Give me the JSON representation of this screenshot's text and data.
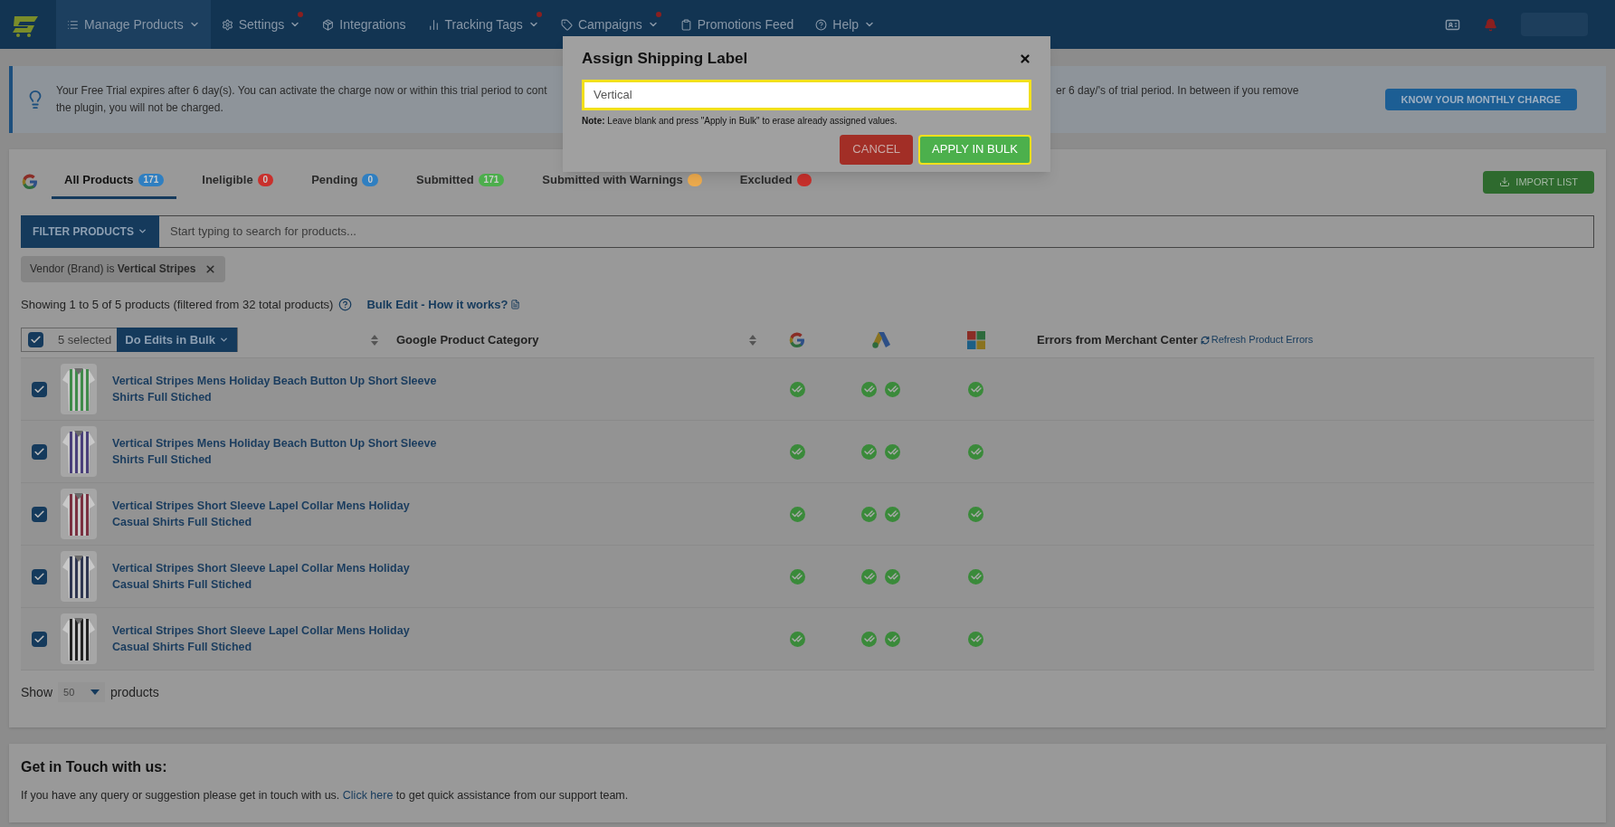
{
  "nav": {
    "items": [
      {
        "label": "Manage Products",
        "selected": true,
        "caret": true,
        "dot": false
      },
      {
        "label": "Settings",
        "selected": false,
        "caret": true,
        "dot": true
      },
      {
        "label": "Integrations",
        "selected": false,
        "caret": false,
        "dot": false
      },
      {
        "label": "Tracking Tags",
        "selected": false,
        "caret": true,
        "dot": true
      },
      {
        "label": "Campaigns",
        "selected": false,
        "caret": true,
        "dot": true
      },
      {
        "label": "Promotions Feed",
        "selected": false,
        "caret": false,
        "dot": false
      },
      {
        "label": "Help",
        "selected": false,
        "caret": true,
        "dot": false
      }
    ]
  },
  "banner": {
    "text_left": "Your Free Trial expires after 6 day(s). You can activate the charge now or within this trial period to cont",
    "text_right": "er 6 day/'s of trial period. In between if you remove",
    "text_line2": "the plugin, you will not be charged.",
    "button": "KNOW YOUR MONTHLY CHARGE"
  },
  "tabs": [
    {
      "label": "All Products",
      "count": "171",
      "color": "#2f7fc1",
      "selected": true
    },
    {
      "label": "Ineligible",
      "count": "0",
      "color": "#c9302c",
      "selected": false
    },
    {
      "label": "Pending",
      "count": "0",
      "color": "#2f7fc1",
      "selected": false
    },
    {
      "label": "Submitted",
      "count": "171",
      "color": "#4cae4c",
      "selected": false
    },
    {
      "label": "Submitted with Warnings",
      "color": "#f0ad4e",
      "selected": false
    },
    {
      "label": "Excluded",
      "color": "#c9302c",
      "selected": false
    }
  ],
  "import_button": "IMPORT LIST",
  "filter": {
    "button": "FILTER PRODUCTS",
    "placeholder": "Start typing to search for products..."
  },
  "chip": {
    "text": "Vendor (Brand) is **Vertical Stripes**"
  },
  "summary": "Showing 1 to 5 of 5 products (filtered from 32 total products)",
  "bulk_link": "Bulk Edit - How it works?",
  "table": {
    "select_all": {
      "checked": true
    },
    "selected_count": "5 selected",
    "bulk_button": "Do Edits in Bulk",
    "category_header": "Google Product Category",
    "errors_header": "Errors from Merchant Center",
    "refresh_link": "Refresh Product Errors",
    "rows": [
      {
        "title": "Vertical Stripes Mens Holiday Beach Button Up Short Sleeve Shirts Full Stiched",
        "checked": true,
        "color": "#3f8a4a",
        "statuses": [
          [
            {
              "approved": true
            }
          ],
          [
            {
              "approved": true
            },
            {
              "approved": true
            }
          ],
          [
            {
              "approved": true
            }
          ]
        ]
      },
      {
        "title": "Vertical Stripes Mens Holiday Beach Button Up Short Sleeve Shirts Full Stiched",
        "checked": true,
        "color": "#4a3f7a",
        "statuses": [
          [
            {
              "approved": true
            }
          ],
          [
            {
              "approved": true
            },
            {
              "approved": true
            }
          ],
          [
            {
              "approved": true
            }
          ]
        ]
      },
      {
        "title": "Vertical Stripes Short Sleeve Lapel Collar Mens Holiday Casual Shirts Full Stiched",
        "checked": true,
        "color": "#7a3040",
        "statuses": [
          [
            {
              "approved": true
            }
          ],
          [
            {
              "approved": true
            },
            {
              "approved": true
            }
          ],
          [
            {
              "approved": true
            }
          ]
        ]
      },
      {
        "title": "Vertical Stripes Short Sleeve Lapel Collar Mens Holiday Casual Shirts Full Stiched",
        "checked": true,
        "color": "#2e3550",
        "statuses": [
          [
            {
              "approved": true
            }
          ],
          [
            {
              "approved": true
            },
            {
              "approved": true
            }
          ],
          [
            {
              "approved": true
            }
          ]
        ]
      },
      {
        "title": "Vertical Stripes Short Sleeve Lapel Collar Mens Holiday Casual Shirts Full Stiched",
        "checked": true,
        "color": "#222222",
        "statuses": [
          [
            {
              "approved": true
            }
          ],
          [
            {
              "approved": true
            },
            {
              "approved": true
            }
          ],
          [
            {
              "approved": true
            }
          ]
        ]
      }
    ]
  },
  "pager": {
    "show": "Show",
    "value": "50",
    "suffix": "products"
  },
  "contact": {
    "title": "Get in Touch with us:",
    "before": "If you have any query or suggestion please get in touch with us.",
    "link": "Click here",
    "after": "to get quick assistance from our support team."
  },
  "modal": {
    "title": "Assign Shipping Label",
    "value": "Vertical",
    "note": "**Note:** Leave blank and press \"Apply in Bulk\" to erase already assigned values.",
    "cancel": "CANCEL",
    "apply": "APPLY IN BULK"
  }
}
